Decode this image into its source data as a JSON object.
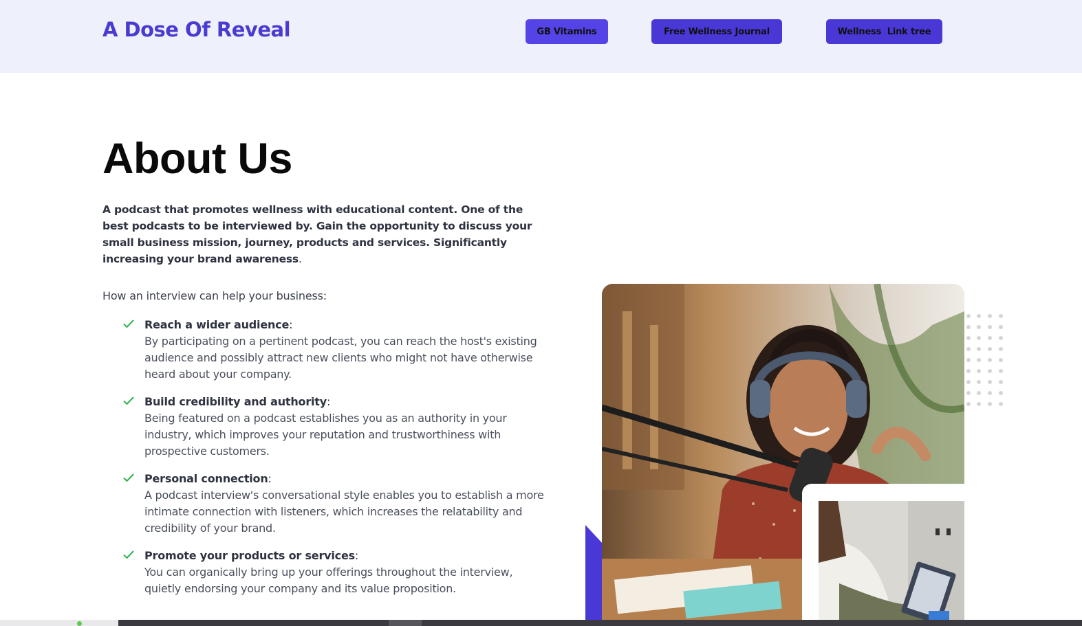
{
  "header": {
    "brand": "A Dose Of Reveal",
    "nav": [
      {
        "label": "GB Vitamins"
      },
      {
        "label": "Free Wellness Journal"
      },
      {
        "label": "Wellness  Link tree"
      }
    ]
  },
  "about": {
    "title": "About Us",
    "intro_bold": "A podcast that promotes wellness with educational content. One of the best podcasts to be interviewed by. Gain the opportunity to discuss your small business mission, journey, products and services. Significantly increasing your brand awareness",
    "intro_tail": ".",
    "lead": "How an interview can help your business:",
    "benefits": [
      {
        "title": "Reach a wider audience",
        "body": "By participating on a pertinent podcast, you can reach the host's existing audience and possibly attract new clients who might not have otherwise heard about your company."
      },
      {
        "title": "Build credibility and authority",
        "body": "Being featured on a podcast establishes you as an authority in your industry, which improves your reputation and trustworthiness with prospective customers."
      },
      {
        "title": "Personal connection",
        "body": "A podcast interview's conversational style enables you to establish a more intimate connection with listeners, which increases the relatability and credibility of your brand."
      },
      {
        "title": "Promote your products or services",
        "body": "You can organically bring up your offerings throughout the interview, quietly endorsing your company and its value proposition."
      }
    ],
    "colon": ":"
  },
  "colors": {
    "brand": "#4a3bd0",
    "button": "#5443e6",
    "header_bg": "#eef1fb",
    "check": "#2bb34a"
  },
  "icons": {
    "check": "check-icon"
  }
}
